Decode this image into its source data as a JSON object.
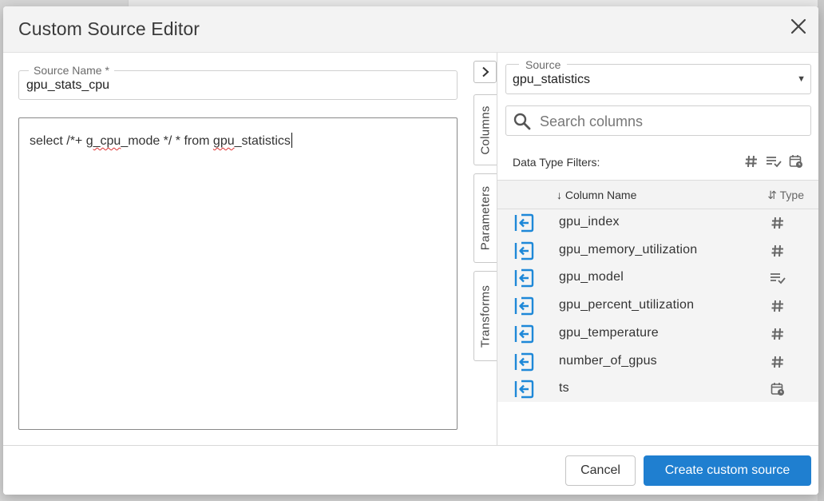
{
  "dialog": {
    "title": "Custom Source Editor"
  },
  "source_name": {
    "label": "Source Name *",
    "value": "gpu_stats_cpu"
  },
  "editor": {
    "text_1": "select /*+ g",
    "text_2_squiggle": "_cpu",
    "text_3": "_mode */ * from ",
    "text_4_squiggle": "gpu",
    "text_5": "_statistics"
  },
  "side_tabs": {
    "columns": "Columns",
    "parameters": "Parameters",
    "transforms": "Transforms"
  },
  "source_select": {
    "label": "Source",
    "value": "gpu_statistics"
  },
  "search": {
    "placeholder": "Search columns"
  },
  "filters": {
    "label": "Data Type Filters:"
  },
  "table": {
    "col_name_header": "Column Name",
    "col_type_header": "Type",
    "rows": [
      {
        "name": "gpu_index",
        "type_icon": "number-type-icon"
      },
      {
        "name": "gpu_memory_utilization",
        "type_icon": "number-type-icon"
      },
      {
        "name": "gpu_model",
        "type_icon": "text-type-icon"
      },
      {
        "name": "gpu_percent_utilization",
        "type_icon": "number-type-icon"
      },
      {
        "name": "gpu_temperature",
        "type_icon": "number-type-icon"
      },
      {
        "name": "number_of_gpus",
        "type_icon": "number-type-icon"
      },
      {
        "name": "ts",
        "type_icon": "datetime-type-icon"
      }
    ]
  },
  "footer": {
    "cancel": "Cancel",
    "create": "Create custom source"
  },
  "colors": {
    "accent": "#1f7fd0",
    "icon_blue": "#1e88d8"
  }
}
